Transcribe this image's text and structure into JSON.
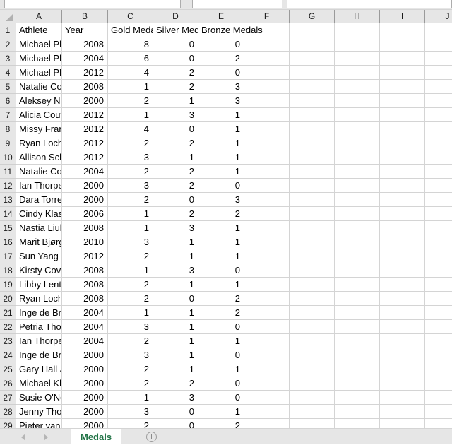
{
  "app": {
    "name": "spreadsheet"
  },
  "grid": {
    "column_letters": [
      "A",
      "B",
      "C",
      "D",
      "E",
      "F",
      "G",
      "H",
      "I",
      "J"
    ],
    "row_numbers": [
      1,
      2,
      3,
      4,
      5,
      6,
      7,
      8,
      9,
      10,
      11,
      12,
      13,
      14,
      15,
      16,
      17,
      18,
      19,
      20,
      21,
      22,
      23,
      24,
      25,
      26,
      27,
      28,
      29
    ],
    "headers": [
      "Athlete",
      "Year",
      "Gold Medals",
      "Silver Medals",
      "Bronze Medals"
    ],
    "rows": [
      {
        "athlete": "Michael Phelps",
        "year": "2008",
        "gold": "8",
        "silver": "0",
        "bronze": "0"
      },
      {
        "athlete": "Michael Phelps",
        "year": "2004",
        "gold": "6",
        "silver": "0",
        "bronze": "2"
      },
      {
        "athlete": "Michael Phelps",
        "year": "2012",
        "gold": "4",
        "silver": "2",
        "bronze": "0"
      },
      {
        "athlete": "Natalie Coughlin",
        "year": "2008",
        "gold": "1",
        "silver": "2",
        "bronze": "3"
      },
      {
        "athlete": "Aleksey Nemov",
        "year": "2000",
        "gold": "2",
        "silver": "1",
        "bronze": "3"
      },
      {
        "athlete": "Alicia Coutts",
        "year": "2012",
        "gold": "1",
        "silver": "3",
        "bronze": "1"
      },
      {
        "athlete": "Missy Franklin",
        "year": "2012",
        "gold": "4",
        "silver": "0",
        "bronze": "1"
      },
      {
        "athlete": "Ryan Lochte",
        "year": "2012",
        "gold": "2",
        "silver": "2",
        "bronze": "1"
      },
      {
        "athlete": "Allison Schmitt",
        "year": "2012",
        "gold": "3",
        "silver": "1",
        "bronze": "1"
      },
      {
        "athlete": "Natalie Coughlin",
        "year": "2004",
        "gold": "2",
        "silver": "2",
        "bronze": "1"
      },
      {
        "athlete": "Ian Thorpe",
        "year": "2000",
        "gold": "3",
        "silver": "2",
        "bronze": "0"
      },
      {
        "athlete": "Dara Torres",
        "year": "2000",
        "gold": "2",
        "silver": "0",
        "bronze": "3"
      },
      {
        "athlete": "Cindy Klassen",
        "year": "2006",
        "gold": "1",
        "silver": "2",
        "bronze": "2"
      },
      {
        "athlete": "Nastia Liukin",
        "year": "2008",
        "gold": "1",
        "silver": "3",
        "bronze": "1"
      },
      {
        "athlete": "Marit Bjørgen",
        "year": "2010",
        "gold": "3",
        "silver": "1",
        "bronze": "1"
      },
      {
        "athlete": "Sun Yang",
        "year": "2012",
        "gold": "2",
        "silver": "1",
        "bronze": "1"
      },
      {
        "athlete": "Kirsty Coventry",
        "year": "2008",
        "gold": "1",
        "silver": "3",
        "bronze": "0"
      },
      {
        "athlete": "Libby Lenton",
        "year": "2008",
        "gold": "2",
        "silver": "1",
        "bronze": "1"
      },
      {
        "athlete": "Ryan Lochte",
        "year": "2008",
        "gold": "2",
        "silver": "0",
        "bronze": "2"
      },
      {
        "athlete": "Inge de Bruijn",
        "year": "2004",
        "gold": "1",
        "silver": "1",
        "bronze": "2"
      },
      {
        "athlete": "Petria Thomas",
        "year": "2004",
        "gold": "3",
        "silver": "1",
        "bronze": "0"
      },
      {
        "athlete": "Ian Thorpe",
        "year": "2004",
        "gold": "2",
        "silver": "1",
        "bronze": "1"
      },
      {
        "athlete": "Inge de Bruijn",
        "year": "2000",
        "gold": "3",
        "silver": "1",
        "bronze": "0"
      },
      {
        "athlete": "Gary Hall Jr.",
        "year": "2000",
        "gold": "2",
        "silver": "1",
        "bronze": "1"
      },
      {
        "athlete": "Michael Klim",
        "year": "2000",
        "gold": "2",
        "silver": "2",
        "bronze": "0"
      },
      {
        "athlete": "Susie O'Neill",
        "year": "2000",
        "gold": "1",
        "silver": "3",
        "bronze": "0"
      },
      {
        "athlete": "Jenny Thompson",
        "year": "2000",
        "gold": "3",
        "silver": "0",
        "bronze": "1"
      },
      {
        "athlete": "Pieter van den Hoogenband",
        "year": "2000",
        "gold": "2",
        "silver": "0",
        "bronze": "2"
      }
    ]
  },
  "sheet_bar": {
    "active_tab": "Medals",
    "active_tab_color": "#217346",
    "prev_icon": "left-arrow-icon",
    "next_icon": "right-arrow-icon",
    "add_icon": "plus-circle-icon"
  }
}
